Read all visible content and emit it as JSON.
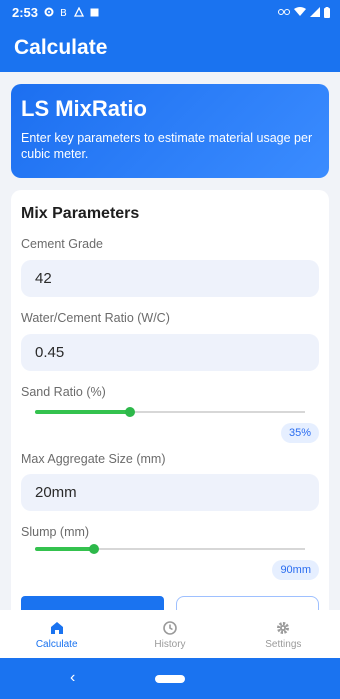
{
  "status": {
    "time": "2:53",
    "left_icons": [
      "gear-icon",
      "b-icon",
      "alert-icon",
      "calendar-icon"
    ],
    "right_icons": [
      "link-icon",
      "wifi-icon",
      "signal-icon",
      "battery-icon"
    ]
  },
  "app_bar": {
    "title": "Calculate"
  },
  "hero": {
    "title": "LS MixRatio",
    "description": "Enter key parameters to estimate material usage per cubic meter."
  },
  "card": {
    "title": "Mix Parameters",
    "cement_grade": {
      "label": "Cement Grade",
      "value": "42"
    },
    "wc_ratio": {
      "label": "Water/Cement Ratio (W/C)",
      "value": "0.45"
    },
    "sand_ratio": {
      "label": "Sand Ratio (%)",
      "display": "35%",
      "fraction": 0.35
    },
    "max_aggregate": {
      "label": "Max Aggregate Size (mm)",
      "value": "20mm"
    },
    "slump": {
      "label": "Slump (mm)",
      "display": "90mm",
      "fraction": 0.22
    }
  },
  "bottom_nav": [
    {
      "label": "Calculate",
      "icon": "home-icon",
      "active": true
    },
    {
      "label": "History",
      "icon": "history-icon",
      "active": false
    },
    {
      "label": "Settings",
      "icon": "gear-icon",
      "active": false
    }
  ],
  "colors": {
    "primary": "#1a73f0",
    "slider": "#34c24e",
    "chip_bg": "#e6efff"
  }
}
